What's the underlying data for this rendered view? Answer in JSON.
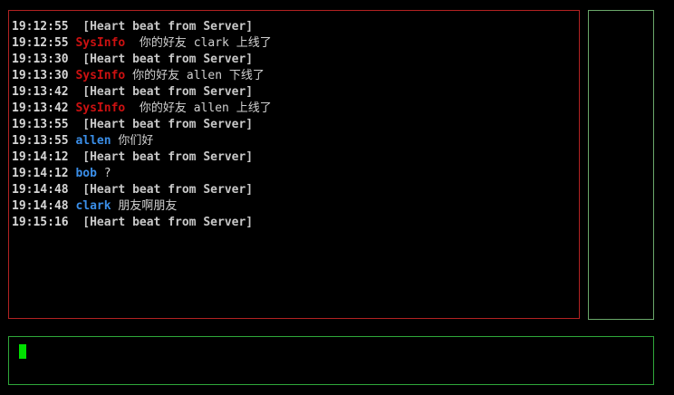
{
  "chat": {
    "messages": [
      {
        "time": "19:12:55",
        "sender": "",
        "sender_type": "",
        "text": " [Heart beat from Server]",
        "kind": "heartbeat"
      },
      {
        "time": "19:12:55",
        "sender": "SysInfo",
        "sender_type": "sys",
        "text": "  你的好友 clark 上线了",
        "kind": "normal"
      },
      {
        "time": "19:13:30",
        "sender": "",
        "sender_type": "",
        "text": " [Heart beat from Server]",
        "kind": "heartbeat"
      },
      {
        "time": "19:13:30",
        "sender": "SysInfo",
        "sender_type": "sys",
        "text": " 你的好友 allen 下线了",
        "kind": "normal"
      },
      {
        "time": "19:13:42",
        "sender": "",
        "sender_type": "",
        "text": " [Heart beat from Server]",
        "kind": "heartbeat"
      },
      {
        "time": "19:13:42",
        "sender": "SysInfo",
        "sender_type": "sys",
        "text": "  你的好友 allen 上线了",
        "kind": "normal"
      },
      {
        "time": "19:13:55",
        "sender": "",
        "sender_type": "",
        "text": " [Heart beat from Server]",
        "kind": "heartbeat"
      },
      {
        "time": "19:13:55",
        "sender": "allen",
        "sender_type": "user",
        "text": " 你们好",
        "kind": "normal"
      },
      {
        "time": "19:14:12",
        "sender": "",
        "sender_type": "",
        "text": " [Heart beat from Server]",
        "kind": "heartbeat"
      },
      {
        "time": "19:14:12",
        "sender": "bob",
        "sender_type": "user",
        "text": " ?",
        "kind": "normal"
      },
      {
        "time": "19:14:48",
        "sender": "",
        "sender_type": "",
        "text": " [Heart beat from Server]",
        "kind": "heartbeat"
      },
      {
        "time": "19:14:48",
        "sender": "clark",
        "sender_type": "user",
        "text": " 朋友啊朋友",
        "kind": "normal"
      },
      {
        "time": "19:15:16",
        "sender": "",
        "sender_type": "",
        "text": " [Heart beat from Server]",
        "kind": "heartbeat"
      }
    ]
  },
  "users": {
    "items": []
  },
  "input": {
    "value": ""
  },
  "colors": {
    "background": "#000000",
    "chat_border": "#b22222",
    "user_list_border": "#6aa86a",
    "input_border": "#2fa83a",
    "cursor": "#00e000",
    "sys_sender": "#cc1111",
    "user_sender": "#3a8ee8"
  }
}
